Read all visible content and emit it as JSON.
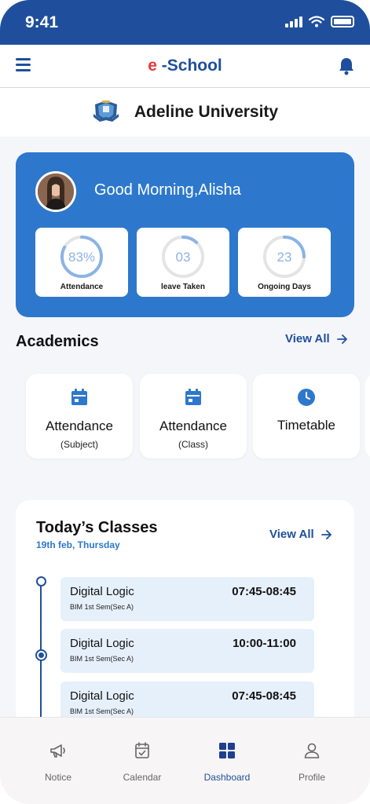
{
  "status_bar": {
    "time": "9:41"
  },
  "header": {
    "brand_prefix": "e",
    "brand_suffix": "-School"
  },
  "university": {
    "name": "Adeline University"
  },
  "greeting": {
    "text": "Good Morning,Alisha",
    "stats": [
      {
        "value": "83%",
        "label": "Attendance",
        "progress": 0.83
      },
      {
        "value": "03",
        "label": "leave Taken",
        "progress": 0.12
      },
      {
        "value": "23",
        "label": "Ongoing Days",
        "progress": 0.25
      }
    ]
  },
  "academics": {
    "title": "Academics",
    "view_all": "View All",
    "cards": [
      {
        "title": "Attendance",
        "subtitle": "(Subject)",
        "icon": "calendar-icon"
      },
      {
        "title": "Attendance",
        "subtitle": "(Class)",
        "icon": "calendar-icon"
      },
      {
        "title": "Timetable",
        "subtitle": "",
        "icon": "clock-icon"
      }
    ]
  },
  "classes": {
    "title": "Today’s Classes",
    "date": "19th feb, Thursday",
    "view_all": "View All",
    "items": [
      {
        "subject": "Digital Logic",
        "semester": "BIM 1st Sem(Sec A)",
        "time": "07:45-08:45"
      },
      {
        "subject": "Digital Logic",
        "semester": "BIM 1st Sem(Sec A)",
        "time": "10:00-11:00"
      },
      {
        "subject": "Digital Logic",
        "semester": "BIM 1st Sem(Sec A)",
        "time": "07:45-08:45"
      }
    ]
  },
  "bottom_nav": {
    "active": "Dashboard",
    "items": [
      {
        "label": "Notice",
        "icon": "megaphone-icon"
      },
      {
        "label": "Calendar",
        "icon": "calendar-check-icon"
      },
      {
        "label": "Dashboard",
        "icon": "dashboard-grid-icon"
      },
      {
        "label": "Profile",
        "icon": "user-icon"
      }
    ]
  },
  "colors": {
    "primary": "#1f4f9c",
    "card_blue": "#2d78cc",
    "brand_accent": "#e23b3b",
    "ring_progress": "#8bb3e6",
    "ring_track": "#e4e4e4",
    "class_bg": "#e6f0fb"
  }
}
